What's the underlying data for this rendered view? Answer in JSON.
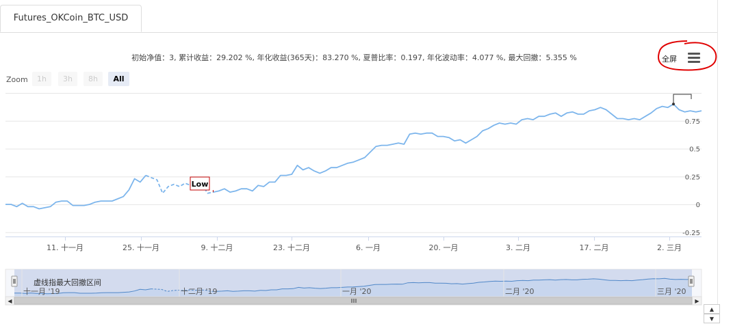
{
  "tab": {
    "label": "Futures_OKCoin_BTC_USD"
  },
  "stats_text": "初始净值：3, 累计收益：29.202 %, 年化收益(365天)：83.270 %, 夏普比率：0.197, 年化波动率：4.077 %, 最大回撤：5.355 %",
  "fullscreen_label": "全屏",
  "zoom": {
    "label": "Zoom",
    "buttons": [
      "1h",
      "3h",
      "8h",
      "All"
    ],
    "active": "All"
  },
  "chart_data": {
    "type": "line",
    "title": "",
    "y_ticks": [
      "0.75",
      "0.5",
      "0.25",
      "0",
      "-0.25"
    ],
    "ylim": [
      -0.25,
      1.0
    ],
    "x_ticks": [
      "11. 十一月",
      "25. 十一月",
      "9. 十二月",
      "23. 十二月",
      "6. 一月",
      "20. 一月",
      "3. 二月",
      "17. 二月",
      "2. 三月"
    ],
    "flags": [
      {
        "text": "Low"
      }
    ],
    "navigator": {
      "note": "虚线指最大回撤区间",
      "labels": [
        "十一月 '19",
        "十二月 '19",
        "一月 '20",
        "二月 '20",
        "三月 '20"
      ]
    },
    "series": [
      {
        "values": [
          0.0,
          0.0,
          -0.02,
          0.01,
          -0.02,
          -0.02,
          -0.04,
          -0.03,
          -0.02,
          0.02,
          0.03,
          0.03,
          -0.01,
          -0.01,
          -0.01,
          0.0,
          0.02,
          0.03,
          0.03,
          0.03,
          0.05,
          0.07,
          0.13,
          0.23,
          0.2,
          0.26,
          0.24,
          0.22,
          0.1,
          0.16,
          0.18,
          0.16,
          0.19,
          0.17,
          0.19,
          0.18,
          0.1,
          0.11,
          0.12,
          0.14,
          0.11,
          0.12,
          0.14,
          0.14,
          0.12,
          0.17,
          0.16,
          0.2,
          0.2,
          0.26,
          0.26,
          0.27,
          0.35,
          0.31,
          0.33,
          0.3,
          0.28,
          0.3,
          0.33,
          0.33,
          0.35,
          0.37,
          0.38,
          0.4,
          0.42,
          0.47,
          0.52,
          0.53,
          0.53,
          0.54,
          0.55,
          0.54,
          0.63,
          0.64,
          0.63,
          0.64,
          0.64,
          0.61,
          0.61,
          0.6,
          0.57,
          0.58,
          0.55,
          0.58,
          0.61,
          0.66,
          0.68,
          0.71,
          0.73,
          0.72,
          0.73,
          0.72,
          0.76,
          0.77,
          0.76,
          0.79,
          0.79,
          0.81,
          0.82,
          0.79,
          0.82,
          0.83,
          0.81,
          0.81,
          0.84,
          0.85,
          0.87,
          0.85,
          0.81,
          0.77,
          0.77,
          0.76,
          0.77,
          0.76,
          0.79,
          0.82,
          0.86,
          0.88,
          0.87,
          0.9,
          0.85,
          0.83,
          0.84,
          0.83,
          0.84
        ],
        "drawdown_range": [
          25,
          37
        ]
      }
    ]
  },
  "colors": {
    "line": "#7cb5ec",
    "navigator_fill": "#ccd6eb",
    "flag_border": "#c00000",
    "annotation": "#e00000"
  }
}
